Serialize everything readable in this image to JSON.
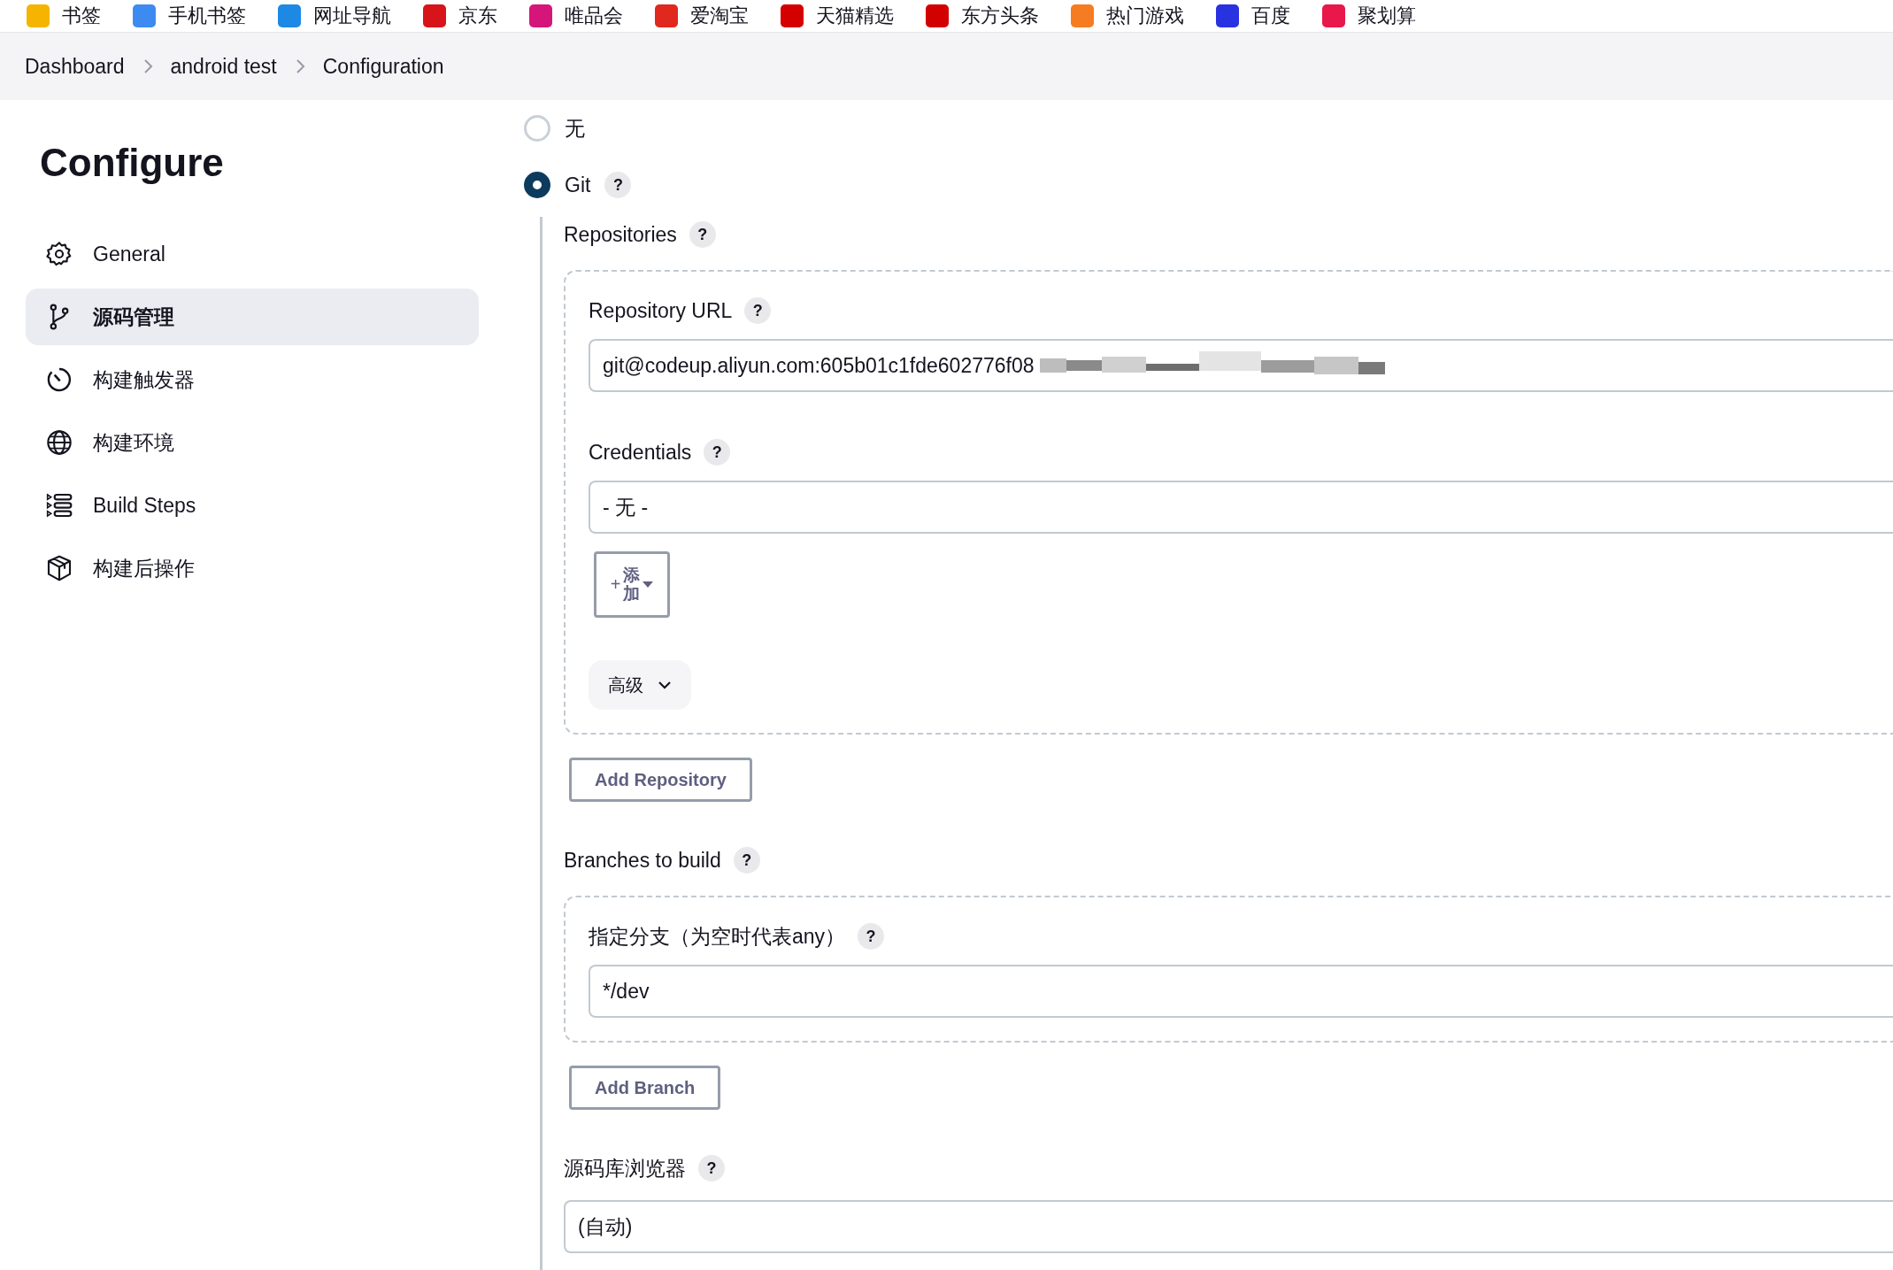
{
  "bookmarks": [
    {
      "label": "书签",
      "color": "#f5b400"
    },
    {
      "label": "手机书签",
      "color": "#3d8bf0"
    },
    {
      "label": "网址导航",
      "color": "#1e88e5"
    },
    {
      "label": "京东",
      "color": "#d7141a"
    },
    {
      "label": "唯品会",
      "color": "#d6157a"
    },
    {
      "label": "爱淘宝",
      "color": "#e0281e"
    },
    {
      "label": "天猫精选",
      "color": "#d40000"
    },
    {
      "label": "东方头条",
      "color": "#d30000"
    },
    {
      "label": "热门游戏",
      "color": "#f57c20"
    },
    {
      "label": "百度",
      "color": "#2932e1"
    },
    {
      "label": "聚划算",
      "color": "#e8184a"
    }
  ],
  "breadcrumbs": [
    "Dashboard",
    "android test",
    "Configuration"
  ],
  "sidebar": {
    "title": "Configure",
    "items": [
      {
        "label": "General",
        "kind": "gear",
        "selected": false
      },
      {
        "label": "源码管理",
        "kind": "branch",
        "selected": true
      },
      {
        "label": "构建触发器",
        "kind": "timer",
        "selected": false
      },
      {
        "label": "构建环境",
        "kind": "globe",
        "selected": false
      },
      {
        "label": "Build Steps",
        "kind": "steps",
        "selected": false
      },
      {
        "label": "构建后操作",
        "kind": "package",
        "selected": false
      }
    ]
  },
  "scm_options": [
    {
      "label": "无",
      "selected": false
    },
    {
      "label": "Git",
      "selected": true,
      "help": "?"
    }
  ],
  "repositories": {
    "label": "Repositories",
    "help": "?",
    "url": {
      "label": "Repository URL",
      "help": "?",
      "value": "git@codeup.aliyun.com:605b01c1fde602776f08"
    },
    "credentials": {
      "label": "Credentials",
      "help": "?",
      "value": "- 无 -"
    },
    "add_button": {
      "plus": "+",
      "label": "添加"
    },
    "advanced_button": "高级",
    "add_repository": "Add Repository"
  },
  "branches": {
    "label": "Branches to build",
    "help": "?",
    "specifier_label": "指定分支（为空时代表any）",
    "specifier_help": "?",
    "value": "*/dev",
    "add_branch": "Add Branch"
  },
  "browser": {
    "label": "源码库浏览器",
    "help": "?",
    "value": "(自动)"
  }
}
